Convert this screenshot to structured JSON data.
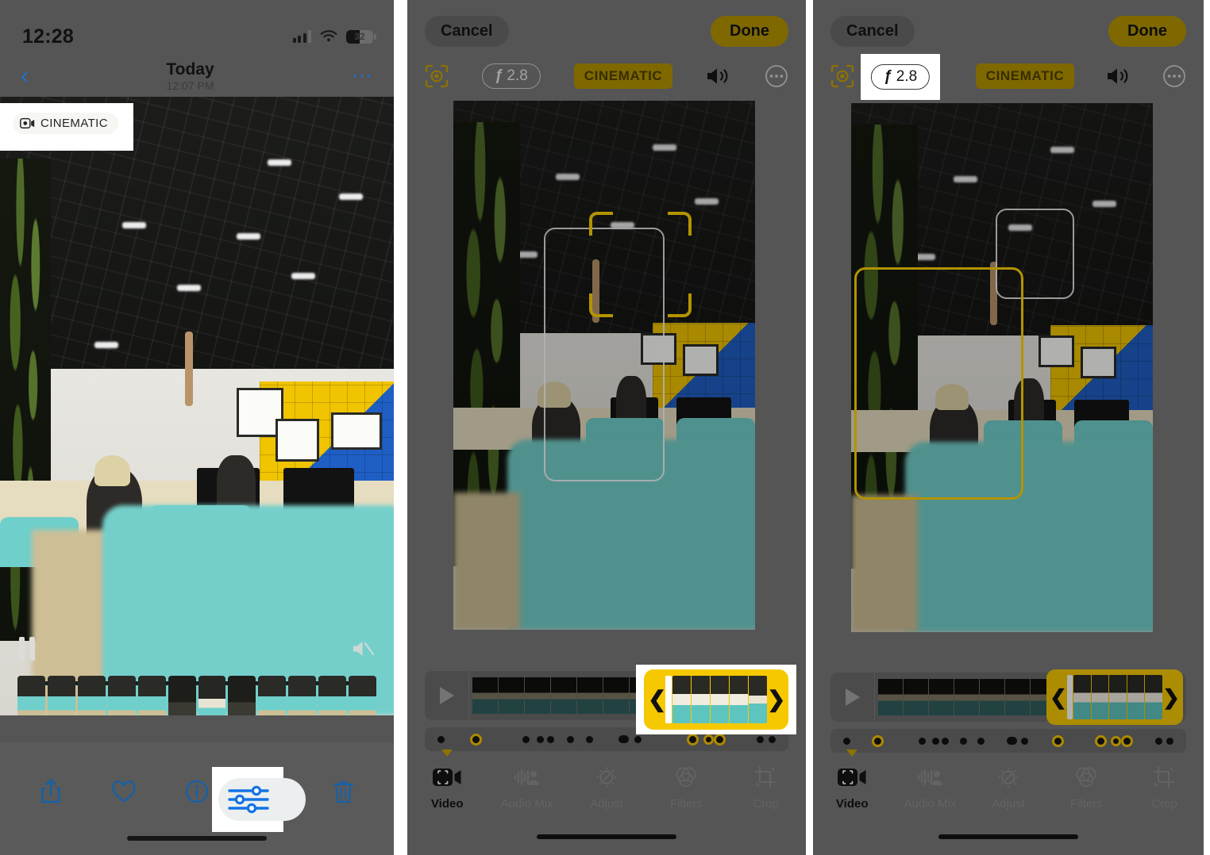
{
  "panel1": {
    "status": {
      "time": "12:28",
      "battery": "32",
      "signal_icon": "cellular-bars-icon",
      "wifi_icon": "wifi-icon",
      "battery_icon": "battery-icon"
    },
    "nav": {
      "back_icon": "chevron-left-icon",
      "title": "Today",
      "subtitle": "12:07 PM",
      "more_icon": "ellipsis-icon"
    },
    "badge": {
      "label": "CINEMATIC",
      "icon": "cinematic-video-icon"
    },
    "playback": {
      "pause_icon": "pause-icon",
      "mute_icon": "speaker-muted-icon"
    },
    "toolbar": [
      {
        "name": "share-button",
        "icon": "share-icon",
        "label": "Share"
      },
      {
        "name": "favorite-button",
        "icon": "heart-icon",
        "label": "Favorite"
      },
      {
        "name": "info-button",
        "icon": "info-circle-icon",
        "label": "Info"
      },
      {
        "name": "edit-button",
        "icon": "sliders-icon",
        "label": "Edit"
      },
      {
        "name": "delete-button",
        "icon": "trash-icon",
        "label": "Delete"
      }
    ],
    "highlighted_control": "edit-button"
  },
  "editor": {
    "cancel_label": "Cancel",
    "done_label": "Done",
    "focus_icon": "focus-target-icon",
    "aperture_value": "2.8",
    "aperture_symbol": "ƒ",
    "cinematic_label": "CINEMATIC",
    "volume_icon": "speaker-on-icon",
    "more_icon": "ellipsis-circle-icon",
    "play_icon": "play-icon",
    "trim_left_icon": "chevron-left-handle-icon",
    "trim_right_icon": "chevron-right-handle-icon",
    "tabs": [
      {
        "label": "Video",
        "icon": "video-cinematic-icon",
        "active": true
      },
      {
        "label": "Audio Mix",
        "icon": "audio-mix-icon",
        "active": false
      },
      {
        "label": "Adjust",
        "icon": "adjust-dial-icon",
        "active": false
      },
      {
        "label": "Filters",
        "icon": "filters-circles-icon",
        "active": false
      },
      {
        "label": "Crop",
        "icon": "crop-rotate-icon",
        "active": false
      }
    ]
  },
  "panel2": {
    "highlighted_control": "trim-selection"
  },
  "panel3": {
    "highlighted_control": "aperture-button"
  },
  "colors": {
    "accent_yellow": "#f6c800",
    "badge_gold": "#b59500",
    "ios_blue": "#1461a8",
    "panel_bg": "#555556",
    "toolbar_bg": "#5a5a5b"
  }
}
